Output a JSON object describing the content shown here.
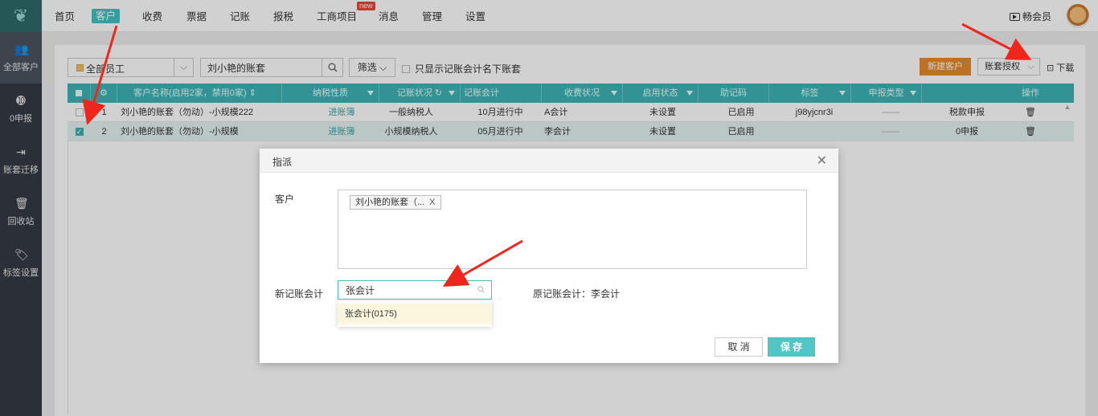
{
  "app": {
    "logo_glyph": "❦"
  },
  "sidebar": {
    "items": [
      {
        "label": "全部客户",
        "icon": "users-icon",
        "glyph": "👥"
      },
      {
        "label": "0申报",
        "icon": "zero-report-icon",
        "glyph": "➓"
      },
      {
        "label": "账套迁移",
        "icon": "migrate-icon",
        "glyph": "⇥"
      },
      {
        "label": "回收站",
        "icon": "trash-icon",
        "glyph": "🗑"
      },
      {
        "label": "标签设置",
        "icon": "tag-icon",
        "glyph": "🏷"
      }
    ]
  },
  "topnav": {
    "items": [
      "首页",
      "客户",
      "收费",
      "票据",
      "记账",
      "报税",
      "工商项目",
      "消息",
      "管理",
      "设置"
    ],
    "badge": "new",
    "vip": "畅会员"
  },
  "toolbar": {
    "employee_select": "全部员工",
    "search_value": "刘小艳的账套",
    "filter_label": "筛选",
    "only_mine_label": "只显示记账会计名下账套",
    "new_client": "新建客户",
    "auth_label": "账套授权",
    "download_label": "下载"
  },
  "table": {
    "headers": [
      "客户名称(启用2家，禁用0家)",
      "纳税性质",
      "记账状况",
      "记账会计",
      "收费状况",
      "启用状态",
      "助记码",
      "标签",
      "申报类型",
      "操作"
    ],
    "rows": [
      {
        "no": "1",
        "name": "刘小艳的账套（勿动）-小规模222",
        "link": "进账簿",
        "tax": "一般纳税人",
        "status": "10月进行中",
        "accountant": "A会计",
        "fee": "未设置",
        "enable": "已启用",
        "code": "j98yjcnr3i",
        "tag": "——",
        "report": "税款申报",
        "checked": false
      },
      {
        "no": "2",
        "name": "刘小艳的账套（勿动）-小规模",
        "link": "进账簿",
        "tax": "小规模纳税人",
        "status": "05月进行中",
        "accountant": "李会计",
        "fee": "未设置",
        "enable": "已启用",
        "code": "",
        "tag": "——",
        "report": "0申报",
        "checked": true
      }
    ]
  },
  "dialog": {
    "title": "指派",
    "customer_label": "客户",
    "customer_tag": "刘小艳的账套（...",
    "tag_close": "X",
    "new_accountant_label": "新记账会计",
    "new_accountant_value": "张会计",
    "suggestion": "张会计(0175)",
    "original_label": "原记账会计：李会计",
    "cancel": "取 消",
    "save": "保 存"
  }
}
